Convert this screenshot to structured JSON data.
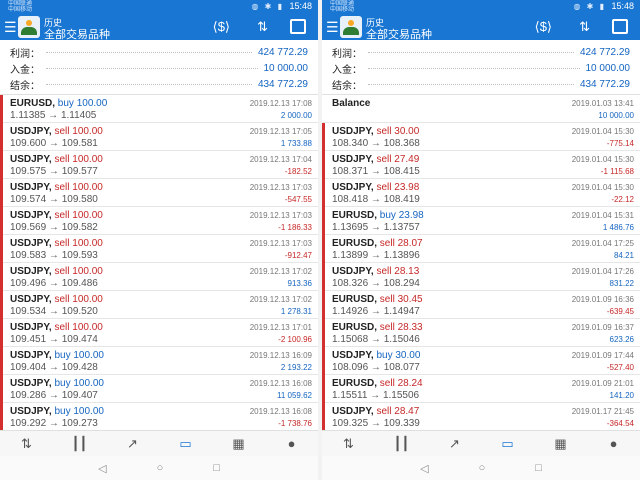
{
  "left": {
    "status": {
      "carrier1": "中国联通",
      "carrier2": "中国移动",
      "time": "15:48"
    },
    "appbar": {
      "title_top": "历史",
      "title_main": "全部交易品种"
    },
    "summary": [
      {
        "label": "利润：",
        "value": "424 772.29"
      },
      {
        "label": "入金：",
        "value": "10 000.00"
      },
      {
        "label": "结余：",
        "value": "434 772.29"
      }
    ],
    "items": [
      {
        "symbol": "EURUSD,",
        "side": "buy 100.00",
        "side_type": "buy",
        "prices": "1.11385 → 1.11405",
        "date": "2019.12.13 17:08",
        "profit": "2 000.00",
        "profit_type": "pos"
      },
      {
        "symbol": "USDJPY,",
        "side": "sell 100.00",
        "side_type": "sell",
        "prices": "109.600 → 109.581",
        "date": "2019.12.13 17:05",
        "profit": "1 733.88",
        "profit_type": "pos"
      },
      {
        "symbol": "USDJPY,",
        "side": "sell 100.00",
        "side_type": "sell",
        "prices": "109.575 → 109.577",
        "date": "2019.12.13 17:04",
        "profit": "-182.52",
        "profit_type": "neg"
      },
      {
        "symbol": "USDJPY,",
        "side": "sell 100.00",
        "side_type": "sell",
        "prices": "109.574 → 109.580",
        "date": "2019.12.13 17:03",
        "profit": "-547.55",
        "profit_type": "neg"
      },
      {
        "symbol": "USDJPY,",
        "side": "sell 100.00",
        "side_type": "sell",
        "prices": "109.569 → 109.582",
        "date": "2019.12.13 17:03",
        "profit": "-1 186.33",
        "profit_type": "neg"
      },
      {
        "symbol": "USDJPY,",
        "side": "sell 100.00",
        "side_type": "sell",
        "prices": "109.583 → 109.593",
        "date": "2019.12.13 17:03",
        "profit": "-912.47",
        "profit_type": "neg"
      },
      {
        "symbol": "USDJPY,",
        "side": "sell 100.00",
        "side_type": "sell",
        "prices": "109.496 → 109.486",
        "date": "2019.12.13 17:02",
        "profit": "913.36",
        "profit_type": "pos"
      },
      {
        "symbol": "USDJPY,",
        "side": "sell 100.00",
        "side_type": "sell",
        "prices": "109.534 → 109.520",
        "date": "2019.12.13 17:02",
        "profit": "1 278.31",
        "profit_type": "pos"
      },
      {
        "symbol": "USDJPY,",
        "side": "sell 100.00",
        "side_type": "sell",
        "prices": "109.451 → 109.474",
        "date": "2019.12.13 17:01",
        "profit": "-2 100.96",
        "profit_type": "neg"
      },
      {
        "symbol": "USDJPY,",
        "side": "buy 100.00",
        "side_type": "buy",
        "prices": "109.404 → 109.428",
        "date": "2019.12.13 16:09",
        "profit": "2 193.22",
        "profit_type": "pos"
      },
      {
        "symbol": "USDJPY,",
        "side": "buy 100.00",
        "side_type": "buy",
        "prices": "109.286 → 109.407",
        "date": "2019.12.13 16:08",
        "profit": "11 059.62",
        "profit_type": "pos"
      },
      {
        "symbol": "USDJPY,",
        "side": "buy 100.00",
        "side_type": "buy",
        "prices": "109.292 → 109.273",
        "date": "2019.12.13 16:08",
        "profit": "-1 738.76",
        "profit_type": "neg"
      }
    ]
  },
  "right": {
    "status": {
      "carrier1": "中国联通",
      "carrier2": "中国移动",
      "time": "15:48"
    },
    "appbar": {
      "title_top": "历史",
      "title_main": "全部交易品种"
    },
    "summary": [
      {
        "label": "利润：",
        "value": "424 772.29"
      },
      {
        "label": "入金：",
        "value": "10 000.00"
      },
      {
        "label": "结余：",
        "value": "434 772.29"
      }
    ],
    "balance": {
      "symbol": "Balance",
      "date": "2019.01.03 13:41",
      "profit": "10 000.00"
    },
    "items": [
      {
        "symbol": "USDJPY,",
        "side": "sell 30.00",
        "side_type": "sell",
        "prices": "108.340 → 108.368",
        "date": "2019.01.04 15:30",
        "profit": "-775.14",
        "profit_type": "neg"
      },
      {
        "symbol": "USDJPY,",
        "side": "sell 27.49",
        "side_type": "sell",
        "prices": "108.371 → 108.415",
        "date": "2019.01.04 15:30",
        "profit": "-1 115.68",
        "profit_type": "neg"
      },
      {
        "symbol": "USDJPY,",
        "side": "sell 23.98",
        "side_type": "sell",
        "prices": "108.418 → 108.419",
        "date": "2019.01.04 15:30",
        "profit": "-22.12",
        "profit_type": "neg"
      },
      {
        "symbol": "EURUSD,",
        "side": "buy 23.98",
        "side_type": "buy",
        "prices": "1.13695 → 1.13757",
        "date": "2019.01.04 15:31",
        "profit": "1 486.76",
        "profit_type": "pos"
      },
      {
        "symbol": "EURUSD,",
        "side": "sell 28.07",
        "side_type": "sell",
        "prices": "1.13899 → 1.13896",
        "date": "2019.01.04 17:25",
        "profit": "84.21",
        "profit_type": "pos"
      },
      {
        "symbol": "USDJPY,",
        "side": "sell 28.13",
        "side_type": "sell",
        "prices": "108.326 → 108.294",
        "date": "2019.01.04 17:26",
        "profit": "831.22",
        "profit_type": "pos"
      },
      {
        "symbol": "EURUSD,",
        "side": "sell 30.45",
        "side_type": "sell",
        "prices": "1.14926 → 1.14947",
        "date": "2019.01.09 16:36",
        "profit": "-639.45",
        "profit_type": "neg"
      },
      {
        "symbol": "EURUSD,",
        "side": "sell 28.33",
        "side_type": "sell",
        "prices": "1.15068 → 1.15046",
        "date": "2019.01.09 16:37",
        "profit": "623.26",
        "profit_type": "pos"
      },
      {
        "symbol": "USDJPY,",
        "side": "buy 30.00",
        "side_type": "buy",
        "prices": "108.096 → 108.077",
        "date": "2019.01.09 17:44",
        "profit": "-527.40",
        "profit_type": "neg"
      },
      {
        "symbol": "EURUSD,",
        "side": "sell 28.24",
        "side_type": "sell",
        "prices": "1.15511 → 1.15506",
        "date": "2019.01.09 21:01",
        "profit": "141.20",
        "profit_type": "pos"
      },
      {
        "symbol": "USDJPY,",
        "side": "sell 28.47",
        "side_type": "sell",
        "prices": "109.325 → 109.339",
        "date": "2019.01.17 21:45",
        "profit": "-364.54",
        "profit_type": "neg"
      }
    ]
  },
  "icons": {
    "menu": "menu-icon",
    "currency_swap": "currency-swap-icon",
    "sort": "sort-icon",
    "calendar": "calendar-icon",
    "tabs": [
      "quotes-tab-icon",
      "chart-tab-icon",
      "trade-tab-icon",
      "history-tab-icon",
      "news-tab-icon",
      "messages-tab-icon"
    ]
  },
  "colors": {
    "primary": "#1976d2",
    "buy": "#1565c0",
    "sell": "#c62828",
    "indicator": "#d32f2f"
  }
}
